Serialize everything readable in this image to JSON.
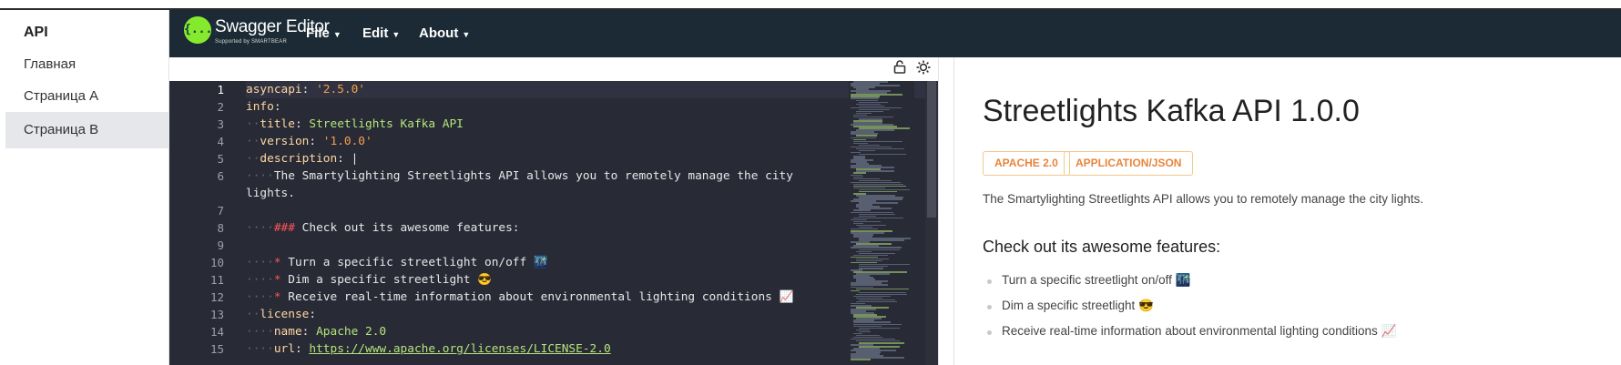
{
  "sidebar": {
    "title": "API",
    "items": [
      {
        "label": "Главная"
      },
      {
        "label": "Страница A"
      },
      {
        "label": "Страница B",
        "active": true
      }
    ]
  },
  "header": {
    "brand": "Swagger Editor",
    "brand_sub": "Supported by SMARTBEAR",
    "logo_glyph": "{...}",
    "menus": [
      {
        "label": "File"
      },
      {
        "label": "Edit"
      },
      {
        "label": "About"
      }
    ],
    "background": "#1b2a35",
    "logo_color": "#85ea2d"
  },
  "toolbar": {
    "lock_icon": "lock-icon",
    "theme_icon": "sun-icon"
  },
  "editor": {
    "line_numbers": [
      "1",
      "2",
      "3",
      "4",
      "5",
      "6",
      "",
      "7",
      "8",
      "9",
      "10",
      "11",
      "12",
      "13",
      "14",
      "15"
    ],
    "lines": {
      "l1_key": "asyncapi",
      "l1_val": "'2.5.0'",
      "l2_key": "info",
      "l3_key": "title",
      "l3_val": "Streetlights Kafka API",
      "l4_key": "version",
      "l4_val": "'1.0.0'",
      "l5_key": "description",
      "l5_val": "|",
      "l6_text": "The Smartylighting Streetlights API allows you to remotely manage the city",
      "l6b_text": "lights.",
      "l8_hash": "###",
      "l8_text": "Check out its awesome features:",
      "l10_bullet": "*",
      "l10_text": "Turn a specific streetlight on/off 🌃",
      "l11_bullet": "*",
      "l11_text": "Dim a specific streetlight 😎",
      "l12_bullet": "*",
      "l12_text": "Receive real-time information about environmental lighting conditions 📈",
      "l13_key": "license",
      "l14_key": "name",
      "l14_val": "Apache 2.0",
      "l15_key": "url",
      "l15_val": "https://www.apache.org/licenses/LICENSE-2.0"
    },
    "background": "#282a36"
  },
  "preview": {
    "title": "Streetlights Kafka API 1.0.0",
    "badges": [
      "APACHE 2.0",
      "APPLICATION/JSON"
    ],
    "description": "The Smartylighting Streetlights API allows you to remotely manage the city lights.",
    "features_heading": "Check out its awesome features:",
    "features": [
      "Turn a specific streetlight on/off 🌃",
      "Dim a specific streetlight 😎",
      "Receive real-time information about environmental lighting conditions 📈"
    ],
    "badge_color": "#e8843a"
  }
}
